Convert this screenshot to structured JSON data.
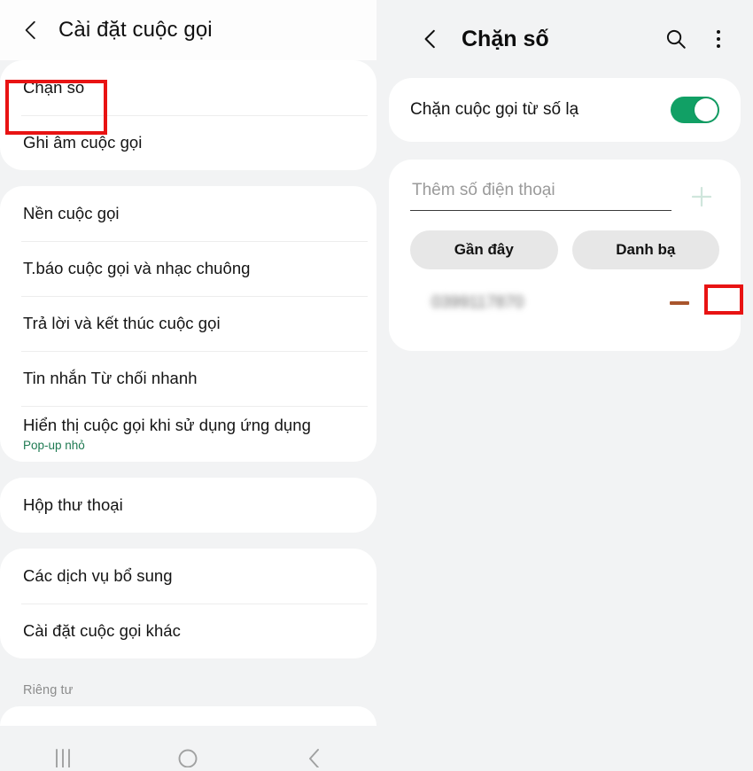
{
  "left_panel": {
    "header": {
      "back_icon": "chevron-left-icon",
      "title": "Cài đặt cuộc gọi"
    },
    "groups": [
      {
        "items": [
          {
            "label": "Chặn số",
            "highlighted": true
          },
          {
            "label": "Ghi âm cuộc gọi"
          }
        ]
      },
      {
        "items": [
          {
            "label": "Nền cuộc gọi"
          },
          {
            "label": "T.báo cuộc gọi và nhạc chuông"
          },
          {
            "label": "Trả lời và kết thúc cuộc gọi"
          },
          {
            "label": "Tin nhắn Từ chối nhanh"
          },
          {
            "label": "Hiển thị cuộc gọi khi sử dụng ứng dụng",
            "sub": "Pop-up nhỏ"
          }
        ]
      },
      {
        "items": [
          {
            "label": "Hộp thư thoại"
          }
        ]
      },
      {
        "items": [
          {
            "label": "Các dịch vụ bổ sung"
          },
          {
            "label": "Cài đặt cuộc gọi khác"
          }
        ]
      }
    ],
    "section_label": "Riêng tư",
    "navbar": {
      "recents_icon": "recents-icon",
      "home_icon": "home-icon",
      "back_icon": "back-icon"
    }
  },
  "right_panel": {
    "header": {
      "back_icon": "chevron-left-icon",
      "title": "Chặn số",
      "search_icon": "search-icon",
      "more_icon": "more-vertical-icon"
    },
    "toggle_row": {
      "label": "Chặn cuộc gọi từ số lạ",
      "enabled": true
    },
    "add_number": {
      "placeholder": "Thêm số điện thoại",
      "value": "",
      "add_icon": "plus-icon"
    },
    "tabs": [
      {
        "label": "Gần đây"
      },
      {
        "label": "Danh bạ"
      }
    ],
    "blocked_list": [
      {
        "number": "0399117870",
        "remove_icon": "minus-icon",
        "highlighted": true
      }
    ]
  },
  "colors": {
    "accent_green": "#11a065",
    "annotation_red": "#e81313",
    "minus_brown": "#a8552c",
    "sub_green": "#1f7a52",
    "page_bg": "#f2f3f4",
    "card_bg": "#ffffff"
  }
}
